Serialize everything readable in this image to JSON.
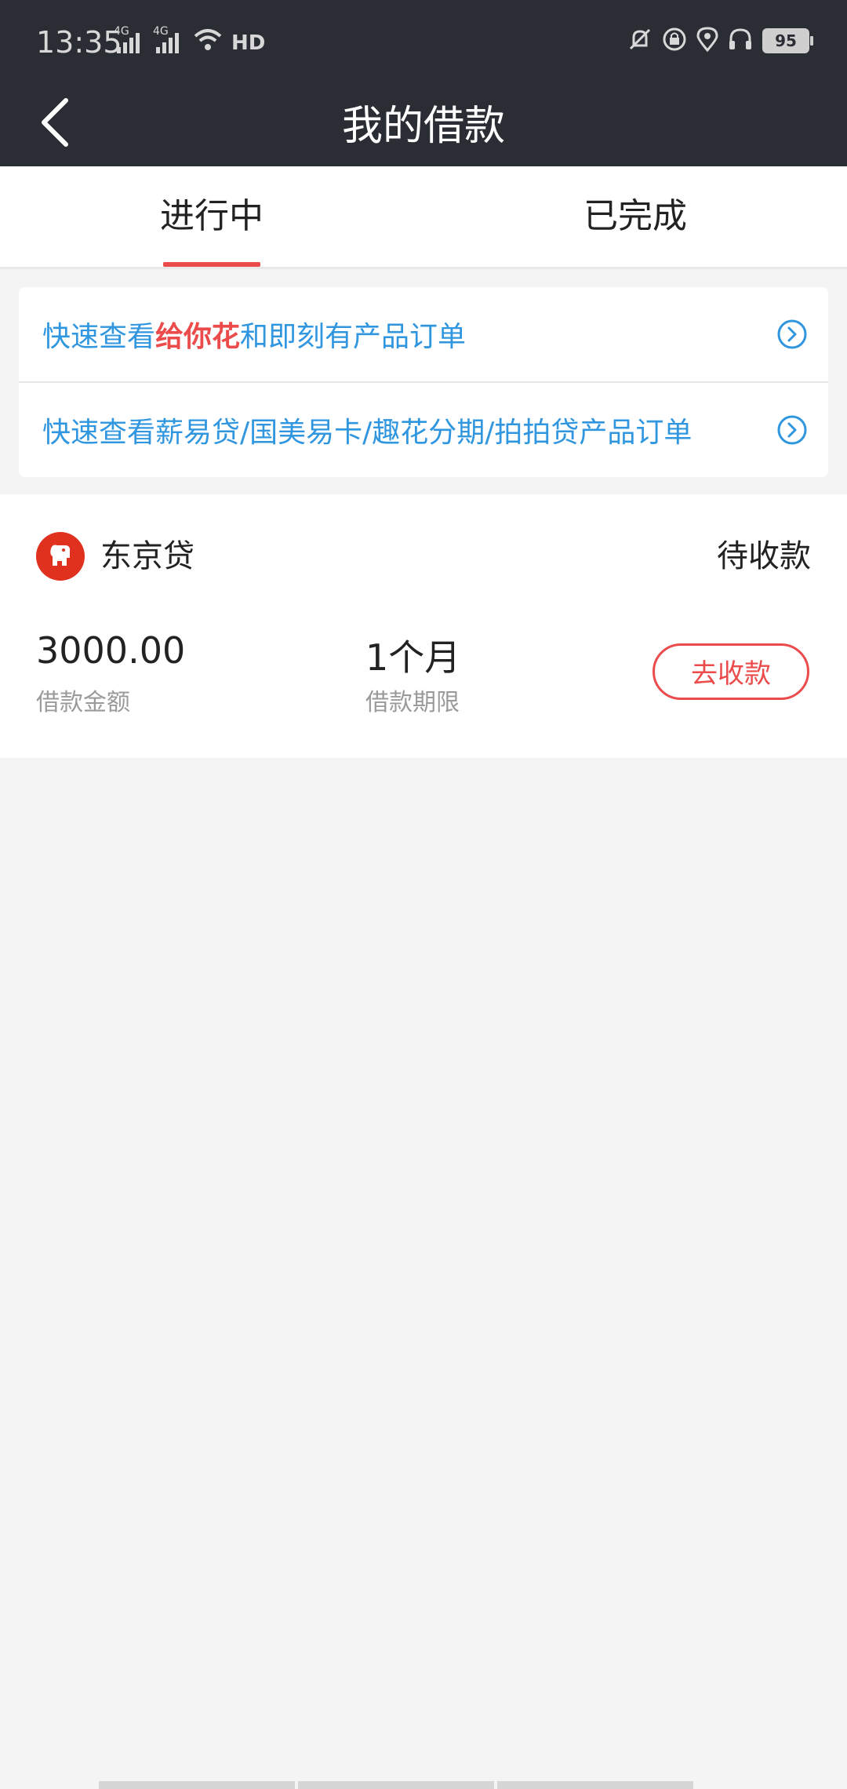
{
  "status_bar": {
    "time": "13:35",
    "network1": "4G",
    "network2": "4G",
    "hd": "HD",
    "battery": "95"
  },
  "nav": {
    "title": "我的借款"
  },
  "tabs": [
    {
      "label": "进行中",
      "active": true
    },
    {
      "label": "已完成",
      "active": false
    }
  ],
  "quick_links": {
    "row1": {
      "prefix": "快速查看",
      "highlight": "给你花",
      "suffix": "和即刻有产品订单"
    },
    "row2": {
      "text": "快速查看薪易贷/国美易卡/趣花分期/拍拍贷产品订单"
    }
  },
  "loan": {
    "name": "东京贷",
    "status": "待收款",
    "amount": "3000.00",
    "amount_label": "借款金额",
    "period": "1个月",
    "period_label": "借款期限",
    "action_label": "去收款"
  },
  "colors": {
    "accent": "#ec4b4b",
    "link": "#2f96df",
    "header": "#2a2d33"
  }
}
